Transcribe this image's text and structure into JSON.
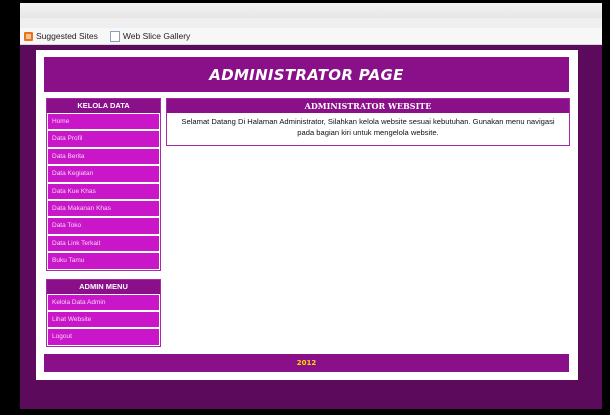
{
  "browser": {
    "favorites": [
      {
        "label": "Suggested Sites",
        "icon": "suggested-sites-icon"
      },
      {
        "label": "Web Slice Gallery",
        "icon": "page-icon"
      }
    ]
  },
  "header": {
    "title": "ADMINISTRATOR PAGE"
  },
  "sidebar": {
    "kelola": {
      "title": "KELOLA DATA",
      "items": [
        {
          "label": "Home"
        },
        {
          "label": "Data Profil"
        },
        {
          "label": "Data Berita"
        },
        {
          "label": "Data Kegiatan"
        },
        {
          "label": "Data Kue Khas"
        },
        {
          "label": "Data Makanan Khas"
        },
        {
          "label": "Data Toko"
        },
        {
          "label": "Data Link Terkait"
        },
        {
          "label": "Buku Tamu"
        }
      ]
    },
    "admin": {
      "title": "ADMIN MENU",
      "items": [
        {
          "label": "Kelola Data Admin"
        },
        {
          "label": "Lihat Website"
        },
        {
          "label": "Logout"
        }
      ]
    }
  },
  "main": {
    "title": "ADMINISTRATOR WEBSITE",
    "text": "Selamat Datang Di Halaman Administrator, Silahkan kelola website sesuai kebutuhan. Gunakan menu navigasi pada bagian kiri untuk mengelola website."
  },
  "footer": {
    "text": "2012"
  },
  "colors": {
    "primary": "#8a108a",
    "nav": "#c916c9",
    "background": "#5c0a5c",
    "footer_text": "#ffd800"
  }
}
